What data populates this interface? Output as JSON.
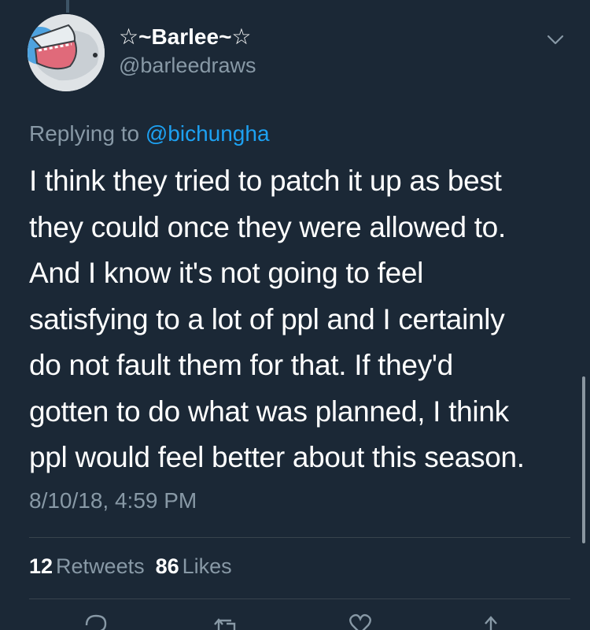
{
  "tweet": {
    "author": {
      "display_name": "☆~Barlee~☆",
      "handle": "@barleedraws"
    },
    "reply": {
      "prefix": "Replying to",
      "mention": "@bichungha"
    },
    "text": "I think they tried to patch it up as best\nthey could once they were allowed to.\nAnd I know it's not going to feel\nsatisfying to a lot of ppl and I certainly\ndo not fault them for that. If they'd\ngotten to do what was planned, I think\nppl would feel better about this season.",
    "timestamp": "8/10/18, 4:59 PM",
    "stats": {
      "retweets_count": "12",
      "retweets_label": "Retweets",
      "likes_count": "86",
      "likes_label": "Likes"
    }
  },
  "icons": {
    "more": "chevron-down-icon",
    "reply": "reply-icon",
    "retweet": "retweet-icon",
    "like": "heart-icon",
    "share": "share-icon"
  },
  "colors": {
    "background": "#1b2836",
    "text": "#ffffff",
    "secondary": "#8899a6",
    "accent": "#1da1f2",
    "divider": "#38444d"
  }
}
